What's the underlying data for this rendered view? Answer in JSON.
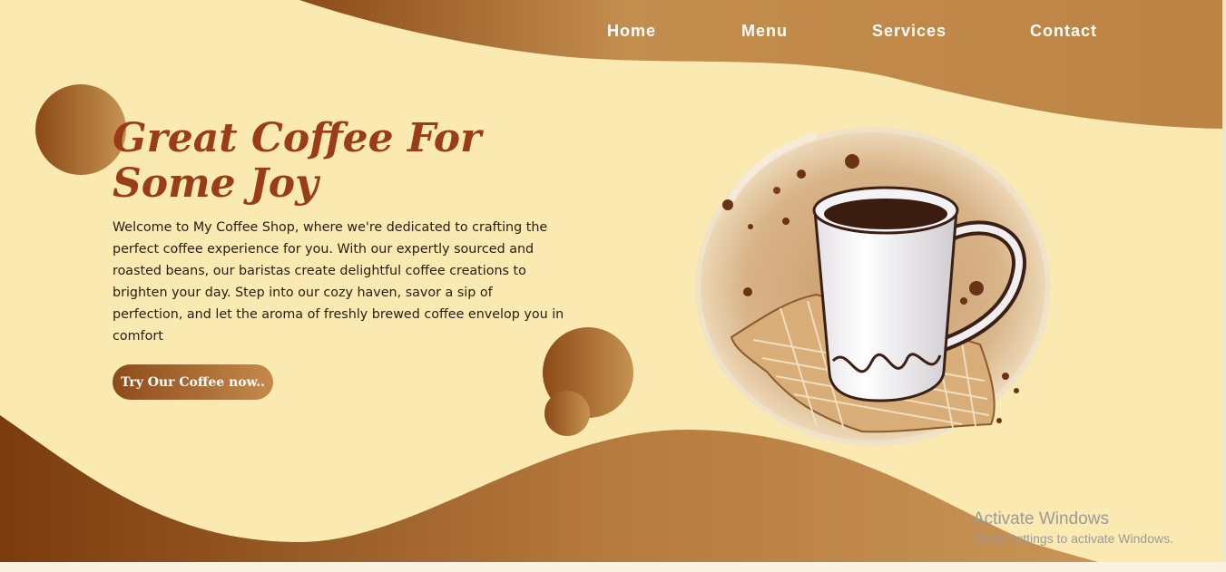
{
  "nav": {
    "items": [
      {
        "label": "Home"
      },
      {
        "label": "Menu"
      },
      {
        "label": "Services"
      },
      {
        "label": "Contact"
      }
    ]
  },
  "hero": {
    "title": "Great Coffee For Some Joy",
    "description": "Welcome to My Coffee Shop, where we're dedicated to crafting the perfect coffee experience for you. With our expertly sourced and roasted beans, our baristas create delightful coffee creations to brighten your day. Step into our cozy haven, savor a sip of perfection, and let the aroma of freshly brewed coffee envelop you in comfort",
    "cta_label": "Try Our Coffee now.."
  },
  "watermark": {
    "title": "Activate Windows",
    "subtitle": "Go to Settings to activate Windows."
  },
  "colors": {
    "background": "#faeab2",
    "brand_brown": "#9a3d17",
    "wave_dark": "#7c3f0e",
    "wave_light": "#c28c4d",
    "nav_text": "#ffffff"
  },
  "icons": {
    "illustration": "coffee-mug-illustration"
  }
}
